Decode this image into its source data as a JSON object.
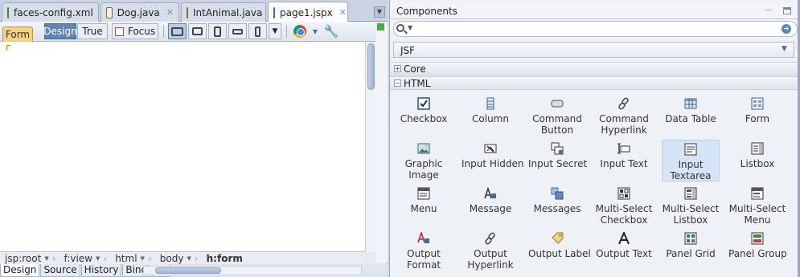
{
  "editor": {
    "tabs": [
      {
        "label": "faces-config.xml",
        "icon": "xml-file-icon"
      },
      {
        "label": "Dog.java",
        "icon": "java-file-icon"
      },
      {
        "label": "IntAnimal.java",
        "icon": "java-file-icon"
      },
      {
        "label": "page1.jspx",
        "icon": "jspx-file-icon",
        "active": true
      }
    ],
    "toolbar": {
      "form_label": "Form",
      "design_label": "Design",
      "true_label": "True",
      "focus_label": "Focus"
    },
    "breadcrumbs": [
      "jsp:root",
      "f:view",
      "html",
      "body",
      "h:form"
    ],
    "bottom_tabs": [
      "Design",
      "Source",
      "History",
      "Bindings"
    ],
    "active_bottom_tab": "Design"
  },
  "palette": {
    "title": "Components",
    "search": {
      "placeholder": ""
    },
    "library": "JSF",
    "categories": [
      {
        "label": "Core",
        "expanded": false
      },
      {
        "label": "HTML",
        "expanded": true
      }
    ],
    "items": [
      {
        "label": "Checkbox",
        "icon": "checkbox-icon"
      },
      {
        "label": "Column",
        "icon": "column-icon"
      },
      {
        "label": "Command\nButton",
        "icon": "command-button-icon"
      },
      {
        "label": "Command\nHyperlink",
        "icon": "hyperlink-icon"
      },
      {
        "label": "Data Table",
        "icon": "data-table-icon"
      },
      {
        "label": "Form",
        "icon": "form-icon"
      },
      {
        "label": "Graphic\nImage",
        "icon": "graphic-image-icon"
      },
      {
        "label": "Input Hidden",
        "icon": "input-hidden-icon"
      },
      {
        "label": "Input Secret",
        "icon": "input-secret-icon"
      },
      {
        "label": "Input Text",
        "icon": "input-text-icon"
      },
      {
        "label": "Input\nTextarea",
        "icon": "input-textarea-icon",
        "selected": true
      },
      {
        "label": "Listbox",
        "icon": "listbox-icon"
      },
      {
        "label": "Menu",
        "icon": "menu-icon"
      },
      {
        "label": "Message",
        "icon": "message-icon"
      },
      {
        "label": "Messages",
        "icon": "messages-icon"
      },
      {
        "label": "Multi-Select\nCheckbox",
        "icon": "multi-select-checkbox-icon"
      },
      {
        "label": "Multi-Select\nListbox",
        "icon": "multi-select-listbox-icon"
      },
      {
        "label": "Multi-Select\nMenu",
        "icon": "multi-select-menu-icon"
      },
      {
        "label": "Output\nFormat",
        "icon": "output-format-icon"
      },
      {
        "label": "Output\nHyperlink",
        "icon": "output-hyperlink-icon"
      },
      {
        "label": "Output Label",
        "icon": "output-label-icon"
      },
      {
        "label": "Output Text",
        "icon": "output-text-icon"
      },
      {
        "label": "Panel Grid",
        "icon": "panel-grid-icon"
      },
      {
        "label": "Panel Group",
        "icon": "panel-group-icon"
      }
    ]
  }
}
